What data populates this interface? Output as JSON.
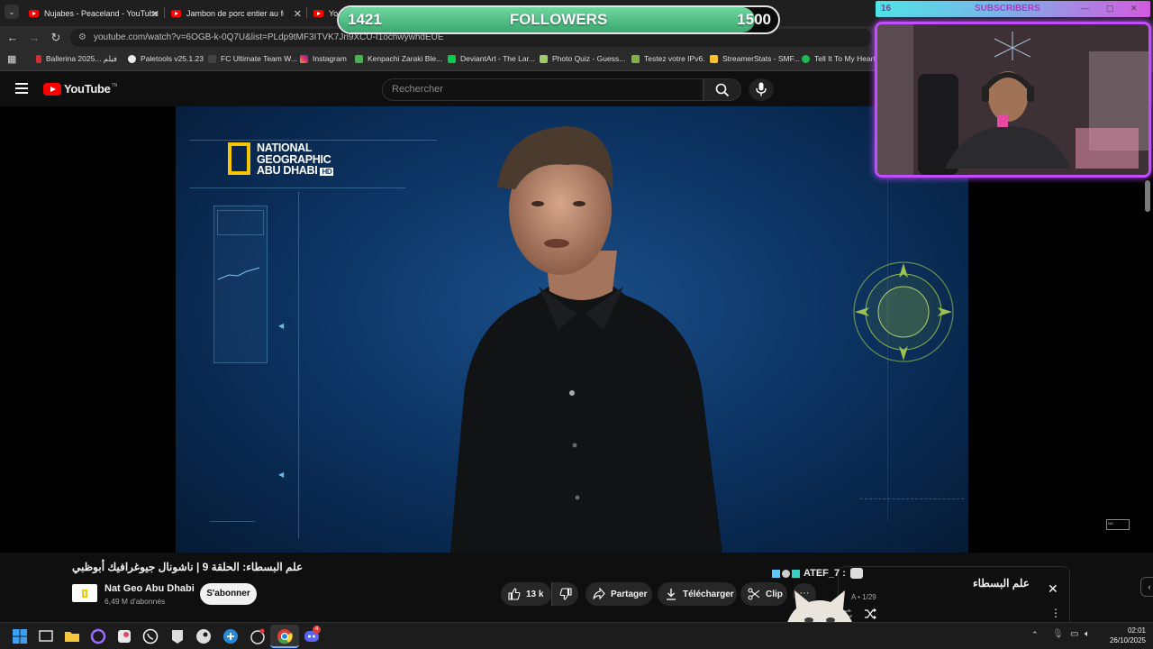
{
  "browser": {
    "tabs": [
      {
        "title": "Nujabes - Peaceland - YouTube"
      },
      {
        "title": "Jambon de porc entier au four"
      },
      {
        "title": "Yo"
      }
    ],
    "url": "youtube.com/watch?v=6OGB-k-0Q7U&list=PLdp9tMF3ITVK7Jn9XCU-I1ochwywhdEUE",
    "bookmarks": [
      {
        "label": "Ballerina 2025... فيلم",
        "color": "#d32f2f"
      },
      {
        "label": "Paletools v25.1.23",
        "color": "#eeeeee"
      },
      {
        "label": "FC Ultimate Team W...",
        "color": "#444444"
      },
      {
        "label": "Instagram",
        "color": "#e1306c"
      },
      {
        "label": "Kenpachi Zaraki Ble...",
        "color": "#4caf50"
      },
      {
        "label": "DeviantArt - The Lar...",
        "color": "#05cc47"
      },
      {
        "label": "Photo Quiz - Guess...",
        "color": "#9ccc65"
      },
      {
        "label": "Testez votre IPv6.",
        "color": "#7cb342"
      },
      {
        "label": "StreamerStats - SMF...",
        "color": "#fbc02d"
      },
      {
        "label": "Tell It To My Heart",
        "color": "#1db954"
      }
    ]
  },
  "youtube": {
    "logo": "YouTube",
    "logo_suffix": "TN",
    "search_placeholder": "Rechercher"
  },
  "video": {
    "brand_lines": [
      "NATIONAL",
      "GEOGRAPHIC",
      "ABU DHABI"
    ],
    "brand_badge": "HD",
    "title": "علم البسطاء: الحلقة 9 | ناشونال جيوغرافيك أبوظبي",
    "channel_name": "Nat Geo Abu Dhabi",
    "channel_subs": "6,49 M d'abonnés",
    "subscribe_label": "S'abonner",
    "likes": "13 k",
    "share_label": "Partager",
    "download_label": "Télécharger",
    "clip_label": "Clip"
  },
  "overlays": {
    "followers_current": "1421",
    "followers_label": "FOLLOWERS",
    "followers_goal": "1500",
    "followers_progress": 0.947,
    "subscribers_count": "16",
    "subscribers_label": "SUBSCRIBERS",
    "chat_user": "ATEF_7 :"
  },
  "playlist_panel": {
    "title": "علم البسطاء",
    "position": "1/29",
    "owner_prefix": "A"
  },
  "taskbar": {
    "time": "02:01",
    "date": "26/10/2025",
    "discord_badge": "4"
  },
  "icons": [
    "search-icon",
    "mic-icon",
    "like-icon",
    "dislike-icon",
    "share-icon",
    "download-icon",
    "scissors-icon",
    "close-icon",
    "shuffle-icon",
    "loop-icon"
  ]
}
